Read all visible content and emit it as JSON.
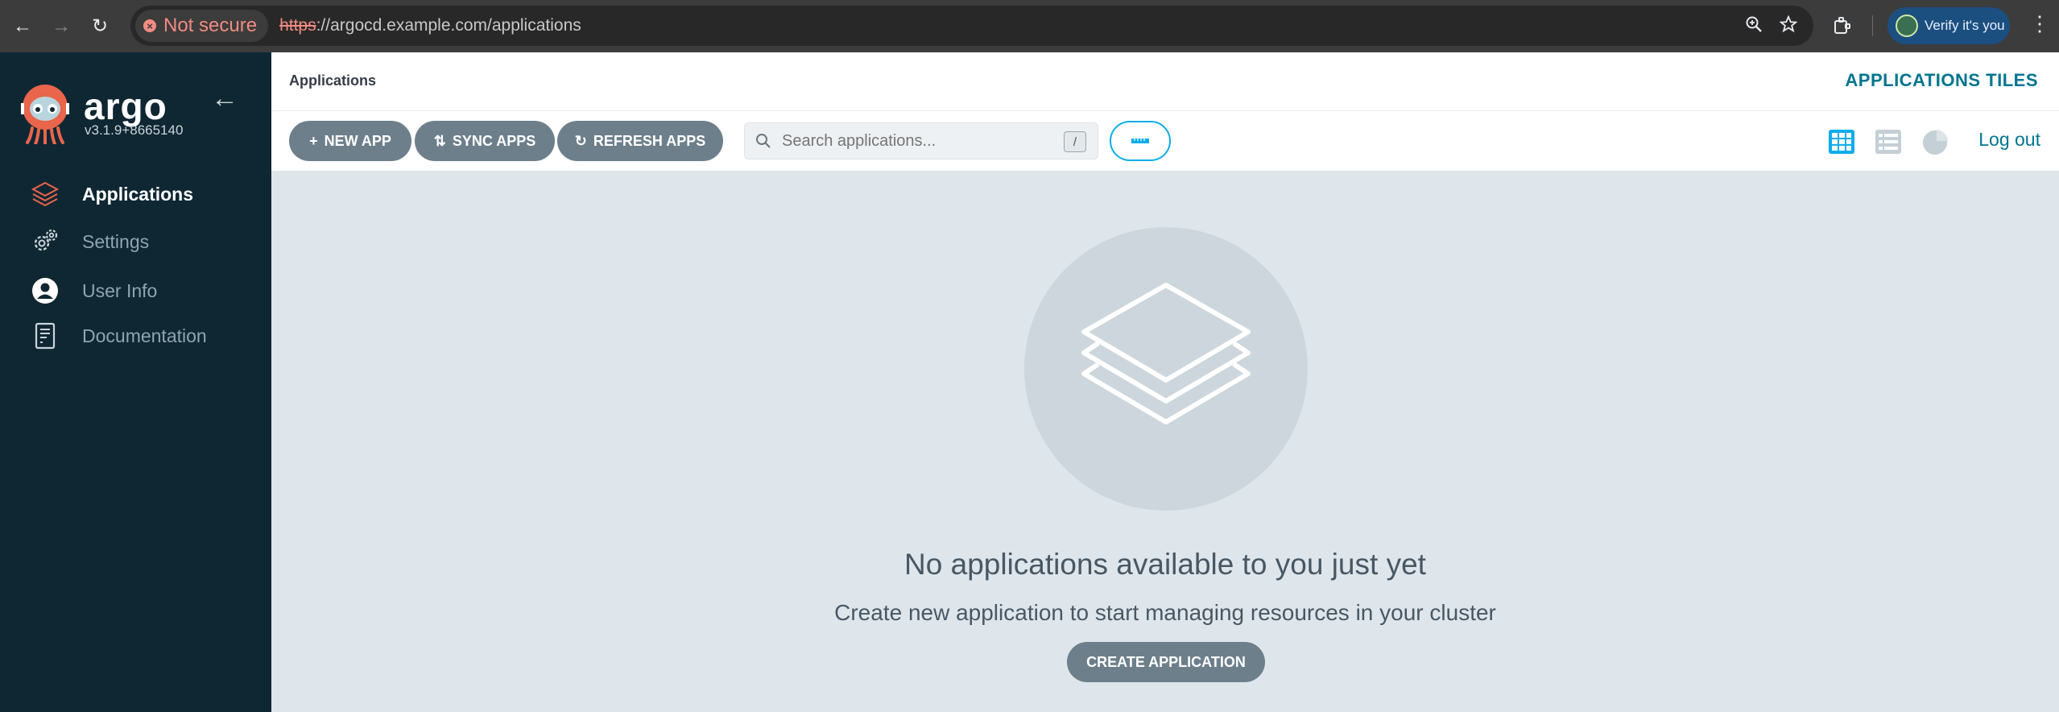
{
  "browser": {
    "security_label": "Not secure",
    "url_scheme": "https",
    "url_rest": "://argocd.example.com/applications",
    "profile_label": "Verify it's you"
  },
  "sidebar": {
    "brand": "argo",
    "version": "v3.1.9+8665140",
    "items": [
      {
        "label": "Applications",
        "icon": "layers-icon",
        "active": true
      },
      {
        "label": "Settings",
        "icon": "gears-icon",
        "active": false
      },
      {
        "label": "User Info",
        "icon": "user-circle-icon",
        "active": false
      },
      {
        "label": "Documentation",
        "icon": "book-icon",
        "active": false
      }
    ]
  },
  "header": {
    "breadcrumb": "Applications",
    "title": "APPLICATIONS TILES"
  },
  "toolbar": {
    "new_app": "NEW APP",
    "sync_apps": "SYNC APPS",
    "refresh_apps": "REFRESH APPS",
    "search_placeholder": "Search applications...",
    "search_shortcut": "/",
    "logout": "Log out"
  },
  "empty_state": {
    "title": "No applications available to you just yet",
    "subtitle": "Create new application to start managing resources in your cluster",
    "create_button": "CREATE APPLICATION"
  },
  "colors": {
    "sidebar_bg": "#0f2733",
    "accent": "#00758f",
    "button_gray": "#6d7f8b",
    "filter_border": "#0dadea",
    "page_bg": "#dee6eb"
  }
}
